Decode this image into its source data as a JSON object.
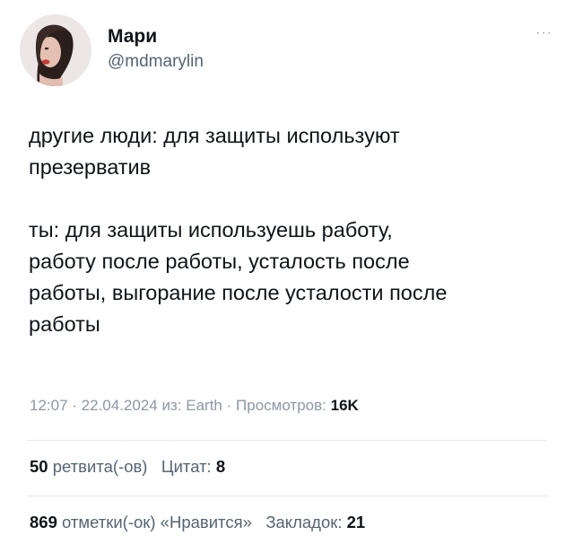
{
  "tweet": {
    "author": {
      "display_name": "Мари",
      "handle": "@mdmarylin"
    },
    "more_label": "···",
    "text": {
      "para1_line1": "другие люди: для защиты используют",
      "para1_line2": "презерватив",
      "para2_line1": "ты: для защиты используешь работу,",
      "para2_line2": "работу после работы, усталость после",
      "para2_line3": "работы, выгорание после усталости после",
      "para2_line4": "работы"
    },
    "meta": {
      "time": "12:07",
      "date": "22.04.2024",
      "source_prefix": "из:",
      "source": "Earth",
      "views_label": "Просмотров:",
      "views_count": "16K"
    },
    "stats_row1": {
      "retweets_count": "50",
      "retweets_label": "ретвита(-ов)",
      "quotes_label": "Цитат:",
      "quotes_count": "8"
    },
    "stats_row2": {
      "likes_count": "869",
      "likes_label": "отметки(-ок) «Нравится»",
      "bookmarks_label": "Закладок:",
      "bookmarks_count": "21"
    }
  }
}
